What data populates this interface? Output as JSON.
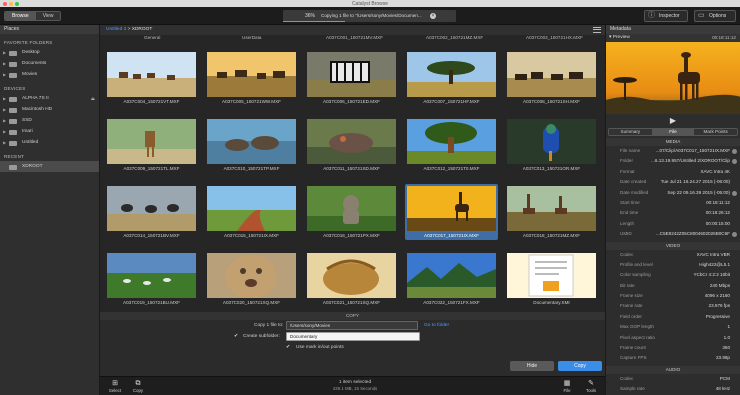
{
  "window": {
    "title": "Catalyst Browse"
  },
  "toolbar": {
    "browse_label": "Browse",
    "view_label": "View",
    "progress_percent": "36%",
    "progress_fraction": 0.36,
    "progress_message": "Copying 1 file to \"/Users/sony/Movies/Documen...",
    "inspector_label": "Inspector",
    "options_label": "Options"
  },
  "sidebar": {
    "header": "Places",
    "favorites_title": "FAVORITE FOLDERS",
    "favorites": [
      "Desktop",
      "Documents",
      "Movies"
    ],
    "devices_title": "DEVICES",
    "devices": [
      "ALPHA 7S II",
      "Macintosh HD",
      "SSD",
      "Imari",
      "Untitled"
    ],
    "recent_title": "RECENT",
    "recent": [
      "XDROOT"
    ]
  },
  "breadcrumb": {
    "parent": "Untitled 2",
    "separator": ">",
    "current": "XDROOT"
  },
  "top_labels": [
    "General",
    "UserData",
    "A037C001_150721MV.MXF",
    "A037C002_150721MZ.MXF",
    "A037C003_150721HX.MXF"
  ],
  "clips": [
    "A037C004_150721VT.MXF",
    "A037C005_150721WW.MXF",
    "A037C006_150721ED.MXF",
    "A037C007_150721HF.MXF",
    "A037C008_150721SH.MXF",
    "A037C009_150721TL.MXF",
    "A037C010_150721TP.MXF",
    "A037C011_150721SD.MXF",
    "A037C012_150721T0.MXF",
    "A037C013_150721OR.MXF",
    "A037C014_150721BV.MXF",
    "A037C015_150721IX.MXF",
    "A037C016_150721PX.MXF",
    "A037C017_150721IX.MXF",
    "A037C018_150721MZ.MXF",
    "A037C019_150721BU.MXF",
    "A037C020_150721XQ.MXF",
    "A037C021_150721SQ.MXF",
    "A037C022_150721FX.MXF",
    "Documentary.SMI"
  ],
  "copy": {
    "header": "COPY",
    "copy_to_label": "Copy 1 file to:",
    "destination": "/Users/sony/Movies",
    "go_to_folder": "Go to folder",
    "create_subfolder_label": "Create subfolder:",
    "subfolder_value": "Documentary",
    "use_mark_label": "Use mark in/out points",
    "hide_label": "Hide",
    "copy_label": "Copy"
  },
  "bottom": {
    "select_label": "Select",
    "copy_label": "Copy",
    "status_line1": "1 item selected",
    "status_line2": "429.1 MB, 15 Seconds",
    "file_label": "File",
    "tools_label": "Tools"
  },
  "metadata": {
    "header": "Metadata",
    "preview_label": "Preview",
    "preview_timecode": "00:18:11:12",
    "tabs": [
      "Summary",
      "File",
      "Mark Points"
    ],
    "active_tab": "File",
    "media_title": "MEDIA",
    "media": [
      {
        "k": "File name",
        "v": "...07/Clip/A037C017_150721IX.MXF"
      },
      {
        "k": "Folder",
        "v": "...6.13.19.957/Untitled 2/XDROOT/Clip"
      },
      {
        "k": "Format",
        "v": "XAVC Intra 4K"
      },
      {
        "k": "Date created",
        "v": "Tue Jul 21 16.24.27 2015 (-06:00)"
      },
      {
        "k": "Date modified",
        "v": "Sep 22 09.16.39 2015 (-05:00)"
      },
      {
        "k": "Start time",
        "v": "00:18:11:12"
      },
      {
        "k": "End time",
        "v": "00:18:26:12"
      },
      {
        "k": "Length",
        "v": "00:00:15:00"
      },
      {
        "k": "UMID",
        "v": "...C5E8242Z05C8004602026B0C6F"
      }
    ],
    "video_title": "VIDEO",
    "video": [
      {
        "k": "Codec",
        "v": "XAVC Intra VBR"
      },
      {
        "k": "Profile and level",
        "v": "High422@L5.1"
      },
      {
        "k": "Color sampling",
        "v": "YCbCr 4:2:2 10bit"
      },
      {
        "k": "Bit rate",
        "v": "240 Mbps"
      },
      {
        "k": "Frame size",
        "v": "4096 x 2160"
      },
      {
        "k": "Frame rate",
        "v": "23.976 fps"
      },
      {
        "k": "Field order",
        "v": "Progressive"
      },
      {
        "k": "Max GOP length",
        "v": "1"
      },
      {
        "k": "Pixel aspect ratio",
        "v": "1.0"
      },
      {
        "k": "Frame count",
        "v": "360"
      },
      {
        "k": "Capture FPS",
        "v": "23.98p"
      }
    ],
    "audio_title": "AUDIO",
    "audio": [
      {
        "k": "Codec",
        "v": "PCM"
      },
      {
        "k": "Sample rate",
        "v": "48 kHz"
      }
    ]
  }
}
